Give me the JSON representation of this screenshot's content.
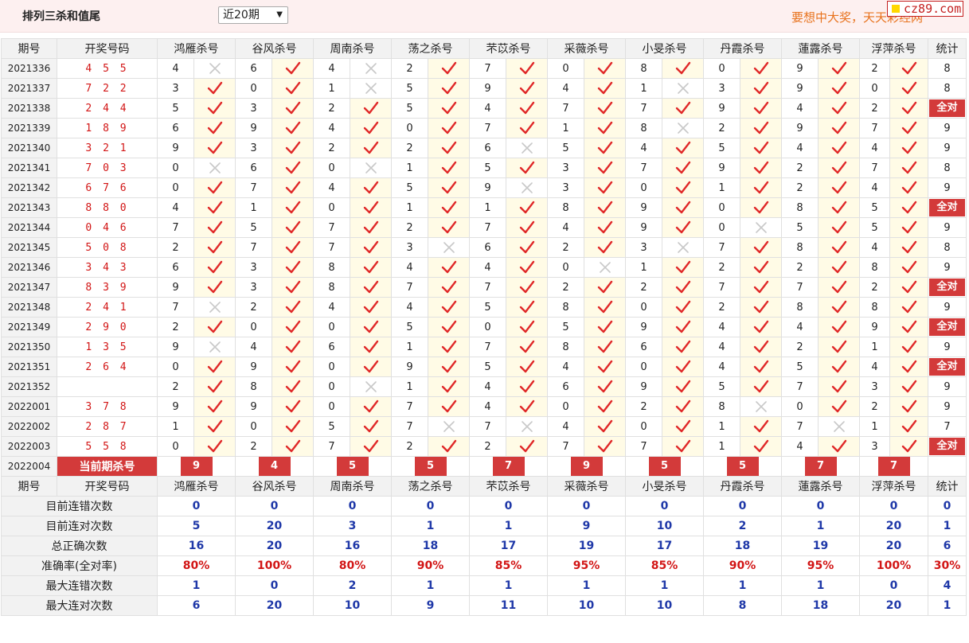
{
  "header": {
    "title": "排列三杀和值尾",
    "period_selected": "近20期",
    "promo": "要想中大奖，天天彩经网",
    "site_logo": "cz89.com"
  },
  "columns": [
    "期号",
    "开奖号码",
    "鸿雁杀号",
    "谷风杀号",
    "周南杀号",
    "荡之杀号",
    "芣苡杀号",
    "采薇杀号",
    "小旻杀号",
    "丹霞杀号",
    "蓮露杀号",
    "浮萍杀号",
    "统计"
  ],
  "rows": [
    {
      "issue": "2021336",
      "win": "4 5 5",
      "kills": [
        "4",
        "6",
        "4",
        "2",
        "7",
        "0",
        "8",
        "0",
        "9",
        "2"
      ],
      "hits": [
        0,
        1,
        0,
        1,
        1,
        1,
        1,
        1,
        1,
        1
      ],
      "total": "8"
    },
    {
      "issue": "2021337",
      "win": "7 2 2",
      "kills": [
        "3",
        "0",
        "1",
        "5",
        "9",
        "4",
        "1",
        "3",
        "9",
        "0"
      ],
      "hits": [
        1,
        1,
        0,
        1,
        1,
        1,
        0,
        1,
        1,
        1
      ],
      "total": "8"
    },
    {
      "issue": "2021338",
      "win": "2 4 4",
      "kills": [
        "5",
        "3",
        "2",
        "5",
        "4",
        "7",
        "7",
        "9",
        "4",
        "2"
      ],
      "hits": [
        1,
        1,
        1,
        1,
        1,
        1,
        1,
        1,
        1,
        1
      ],
      "total": "全对"
    },
    {
      "issue": "2021339",
      "win": "1 8 9",
      "kills": [
        "6",
        "9",
        "4",
        "0",
        "7",
        "1",
        "8",
        "2",
        "9",
        "7"
      ],
      "hits": [
        1,
        1,
        1,
        1,
        1,
        1,
        0,
        1,
        1,
        1
      ],
      "total": "9"
    },
    {
      "issue": "2021340",
      "win": "3 2 1",
      "kills": [
        "9",
        "3",
        "2",
        "2",
        "6",
        "5",
        "4",
        "5",
        "4",
        "4"
      ],
      "hits": [
        1,
        1,
        1,
        1,
        0,
        1,
        1,
        1,
        1,
        1
      ],
      "total": "9"
    },
    {
      "issue": "2021341",
      "win": "7 0 3",
      "kills": [
        "0",
        "6",
        "0",
        "1",
        "5",
        "3",
        "7",
        "9",
        "2",
        "7"
      ],
      "hits": [
        0,
        1,
        0,
        1,
        1,
        1,
        1,
        1,
        1,
        1
      ],
      "total": "8"
    },
    {
      "issue": "2021342",
      "win": "6 7 6",
      "kills": [
        "0",
        "7",
        "4",
        "5",
        "9",
        "3",
        "0",
        "1",
        "2",
        "4"
      ],
      "hits": [
        1,
        1,
        1,
        1,
        0,
        1,
        1,
        1,
        1,
        1
      ],
      "total": "9"
    },
    {
      "issue": "2021343",
      "win": "8 8 0",
      "kills": [
        "4",
        "1",
        "0",
        "1",
        "1",
        "8",
        "9",
        "0",
        "8",
        "5"
      ],
      "hits": [
        1,
        1,
        1,
        1,
        1,
        1,
        1,
        1,
        1,
        1
      ],
      "total": "全对"
    },
    {
      "issue": "2021344",
      "win": "0 4 6",
      "kills": [
        "7",
        "5",
        "7",
        "2",
        "7",
        "4",
        "9",
        "0",
        "5",
        "5"
      ],
      "hits": [
        1,
        1,
        1,
        1,
        1,
        1,
        1,
        0,
        1,
        1
      ],
      "total": "9"
    },
    {
      "issue": "2021345",
      "win": "5 0 8",
      "kills": [
        "2",
        "7",
        "7",
        "3",
        "6",
        "2",
        "3",
        "7",
        "8",
        "4"
      ],
      "hits": [
        1,
        1,
        1,
        0,
        1,
        1,
        0,
        1,
        1,
        1
      ],
      "total": "8"
    },
    {
      "issue": "2021346",
      "win": "3 4 3",
      "kills": [
        "6",
        "3",
        "8",
        "4",
        "4",
        "0",
        "1",
        "2",
        "2",
        "8"
      ],
      "hits": [
        1,
        1,
        1,
        1,
        1,
        0,
        1,
        1,
        1,
        1
      ],
      "total": "9"
    },
    {
      "issue": "2021347",
      "win": "8 3 9",
      "kills": [
        "9",
        "3",
        "8",
        "7",
        "7",
        "2",
        "2",
        "7",
        "7",
        "2"
      ],
      "hits": [
        1,
        1,
        1,
        1,
        1,
        1,
        1,
        1,
        1,
        1
      ],
      "total": "全对"
    },
    {
      "issue": "2021348",
      "win": "2 4 1",
      "kills": [
        "7",
        "2",
        "4",
        "4",
        "5",
        "8",
        "0",
        "2",
        "8",
        "8"
      ],
      "hits": [
        0,
        1,
        1,
        1,
        1,
        1,
        1,
        1,
        1,
        1
      ],
      "total": "9"
    },
    {
      "issue": "2021349",
      "win": "2 9 0",
      "kills": [
        "2",
        "0",
        "0",
        "5",
        "0",
        "5",
        "9",
        "4",
        "4",
        "9"
      ],
      "hits": [
        1,
        1,
        1,
        1,
        1,
        1,
        1,
        1,
        1,
        1
      ],
      "total": "全对"
    },
    {
      "issue": "2021350",
      "win": "1 3 5",
      "kills": [
        "9",
        "4",
        "6",
        "1",
        "7",
        "8",
        "6",
        "4",
        "2",
        "1"
      ],
      "hits": [
        0,
        1,
        1,
        1,
        1,
        1,
        1,
        1,
        1,
        1
      ],
      "total": "9"
    },
    {
      "issue": "2021351",
      "win": "2 6 4",
      "kills": [
        "0",
        "9",
        "0",
        "9",
        "5",
        "4",
        "0",
        "4",
        "5",
        "4"
      ],
      "hits": [
        1,
        1,
        1,
        1,
        1,
        1,
        1,
        1,
        1,
        1
      ],
      "total": "全对"
    },
    {
      "issue": "2021352",
      "win": "",
      "kills": [
        "2",
        "8",
        "0",
        "1",
        "4",
        "6",
        "9",
        "5",
        "7",
        "3"
      ],
      "hits": [
        1,
        1,
        0,
        1,
        1,
        1,
        1,
        1,
        1,
        1
      ],
      "total": "9"
    },
    {
      "issue": "2022001",
      "win": "3 7 8",
      "kills": [
        "9",
        "9",
        "0",
        "7",
        "4",
        "0",
        "2",
        "8",
        "0",
        "2"
      ],
      "hits": [
        1,
        1,
        1,
        1,
        1,
        1,
        1,
        0,
        1,
        1
      ],
      "total": "9"
    },
    {
      "issue": "2022002",
      "win": "2 8 7",
      "kills": [
        "1",
        "0",
        "5",
        "7",
        "7",
        "4",
        "0",
        "1",
        "7",
        "1"
      ],
      "hits": [
        1,
        1,
        1,
        0,
        0,
        1,
        1,
        1,
        0,
        1
      ],
      "total": "7"
    },
    {
      "issue": "2022003",
      "win": "5 5 8",
      "kills": [
        "0",
        "2",
        "7",
        "2",
        "2",
        "7",
        "7",
        "1",
        "4",
        "3"
      ],
      "hits": [
        1,
        1,
        1,
        1,
        1,
        1,
        1,
        1,
        1,
        1
      ],
      "total": "全对"
    }
  ],
  "current": {
    "issue": "2022004",
    "label": "当前期杀号",
    "kills": [
      "9",
      "4",
      "5",
      "5",
      "7",
      "9",
      "5",
      "5",
      "7",
      "7"
    ]
  },
  "stats": [
    {
      "label": "目前连错次数",
      "values": [
        "0",
        "0",
        "0",
        "0",
        "0",
        "0",
        "0",
        "0",
        "0",
        "0",
        "0"
      ]
    },
    {
      "label": "目前连对次数",
      "values": [
        "5",
        "20",
        "3",
        "1",
        "1",
        "9",
        "10",
        "2",
        "1",
        "20",
        "1"
      ]
    },
    {
      "label": "总正确次数",
      "values": [
        "16",
        "20",
        "16",
        "18",
        "17",
        "19",
        "17",
        "18",
        "19",
        "20",
        "6"
      ]
    },
    {
      "label": "准确率(全对率)",
      "values": [
        "80%",
        "100%",
        "80%",
        "90%",
        "85%",
        "95%",
        "85%",
        "90%",
        "95%",
        "100%",
        "30%"
      ],
      "highlight": true
    },
    {
      "label": "最大连错次数",
      "values": [
        "1",
        "0",
        "2",
        "1",
        "1",
        "1",
        "1",
        "1",
        "1",
        "0",
        "4"
      ]
    },
    {
      "label": "最大连对次数",
      "values": [
        "6",
        "20",
        "10",
        "9",
        "11",
        "10",
        "10",
        "8",
        "18",
        "20",
        "1"
      ]
    }
  ],
  "colors": {
    "hit": "#e02828",
    "miss": "#c8c8c8",
    "accent": "#d33a3a",
    "stat_blue": "#1f38a8"
  },
  "icons": {
    "hit": "check-icon",
    "miss": "cross-icon"
  }
}
